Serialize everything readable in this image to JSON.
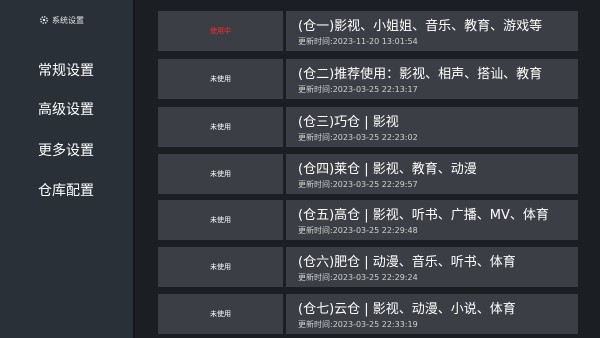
{
  "sidebar": {
    "header": "系统设置",
    "header_icon": "gear-icon",
    "items": [
      {
        "label": "常规设置"
      },
      {
        "label": "高级设置"
      },
      {
        "label": "更多设置"
      },
      {
        "label": "仓库配置"
      }
    ]
  },
  "colors": {
    "background": "#1b1f24",
    "sidebar": "#2a3038",
    "card": "#3b3f45",
    "active_status": "#ff2a2a"
  },
  "repos": [
    {
      "status": "使用中",
      "active": true,
      "title": "(仓一)影视、小姐姐、音乐、教育、游戏等",
      "time": "更新时间:2023-11-20 13:01:54"
    },
    {
      "status": "未使用",
      "active": false,
      "title": "(仓二)推荐使用：影视、相声、搭讪、教育",
      "time": "更新时间:2023-03-25 22:13:17"
    },
    {
      "status": "未使用",
      "active": false,
      "title": "(仓三)巧仓 | 影视",
      "time": "更新时间:2023-03-25 22:23:02"
    },
    {
      "status": "未使用",
      "active": false,
      "title": "(仓四)莱仓 | 影视、教育、动漫",
      "time": "更新时间:2023-03-25 22:29:57"
    },
    {
      "status": "未使用",
      "active": false,
      "title": "(仓五)高仓 | 影视、听书、广播、MV、体育",
      "time": "更新时间:2023-03-25 22:29:48"
    },
    {
      "status": "未使用",
      "active": false,
      "title": "(仓六)肥仓 | 动漫、音乐、听书、体育",
      "time": "更新时间:2023-03-25 22:29:24"
    },
    {
      "status": "未使用",
      "active": false,
      "title": "(仓七)云仓 | 影视、动漫、小说、体育",
      "time": "更新时间:2023-03-25 22:33:19"
    }
  ]
}
